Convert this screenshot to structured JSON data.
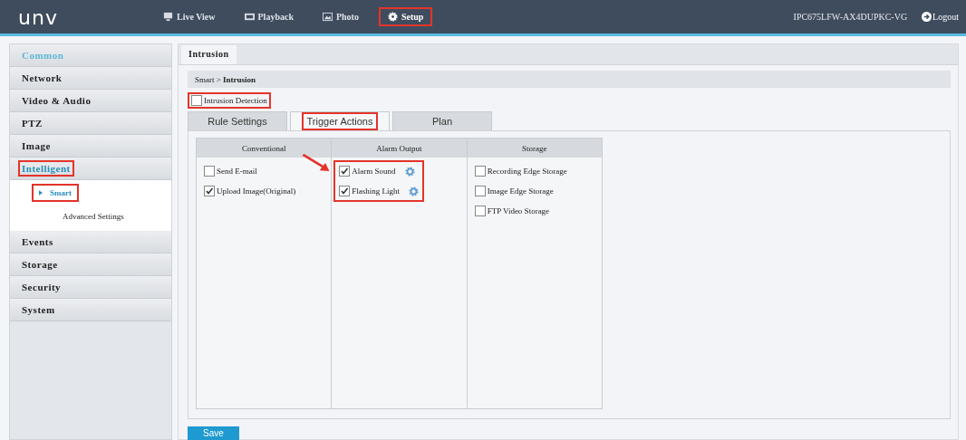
{
  "header": {
    "logo": "unv",
    "nav": [
      {
        "label": "Live View",
        "selected": false,
        "highlighted": false
      },
      {
        "label": "Playback",
        "selected": false,
        "highlighted": false
      },
      {
        "label": "Photo",
        "selected": false,
        "highlighted": false
      },
      {
        "label": "Setup",
        "selected": true,
        "highlighted": true
      }
    ],
    "device": "IPC675LFW-AX4DUPKC-VG",
    "logout": "Logout"
  },
  "sidebar": [
    {
      "label": "Common",
      "kind": "header",
      "selected": false,
      "highlighted": false
    },
    {
      "label": "Network",
      "kind": "item",
      "selected": false,
      "highlighted": false
    },
    {
      "label": "Video & Audio",
      "kind": "item",
      "selected": false,
      "highlighted": false
    },
    {
      "label": "PTZ",
      "kind": "item",
      "selected": false,
      "highlighted": false
    },
    {
      "label": "Image",
      "kind": "item",
      "selected": false,
      "highlighted": false
    },
    {
      "label": "Intelligent",
      "kind": "item",
      "selected": true,
      "highlighted": true,
      "children": [
        {
          "label": "Smart",
          "selected": true,
          "highlighted": true
        },
        {
          "label": "Advanced Settings",
          "selected": false,
          "highlighted": false
        }
      ]
    },
    {
      "label": "Events",
      "kind": "item",
      "selected": false,
      "highlighted": false
    },
    {
      "label": "Storage",
      "kind": "item",
      "selected": false,
      "highlighted": false
    },
    {
      "label": "Security",
      "kind": "item",
      "selected": false,
      "highlighted": false
    },
    {
      "label": "System",
      "kind": "item",
      "selected": false,
      "highlighted": false
    }
  ],
  "page_tab": "Intrusion",
  "breadcrumb": "Smart > **Intrusion**",
  "enable": {
    "label": "Intrusion Detection",
    "checked": false,
    "highlighted": true
  },
  "tabs": [
    {
      "label": "Rule Settings",
      "selected": false,
      "highlighted": false
    },
    {
      "label": "Trigger Actions",
      "selected": true,
      "highlighted": true
    },
    {
      "label": "Plan",
      "selected": false,
      "highlighted": false
    }
  ],
  "columns": [
    {
      "title": "Conventional",
      "highlighted": false,
      "options": [
        {
          "label": "Send E-mail",
          "checked": false,
          "settings": false
        },
        {
          "label": "Upload Image(Original)",
          "checked": true,
          "settings": false
        }
      ]
    },
    {
      "title": "Alarm Output",
      "highlighted": true,
      "options": [
        {
          "label": "Alarm Sound",
          "checked": true,
          "settings": true
        },
        {
          "label": "Flashing Light",
          "checked": true,
          "settings": true
        }
      ]
    },
    {
      "title": "Storage",
      "highlighted": false,
      "options": [
        {
          "label": "Recording Edge Storage",
          "checked": false,
          "settings": false
        },
        {
          "label": "Image Edge Storage",
          "checked": false,
          "settings": false
        },
        {
          "label": "FTP Video Storage",
          "checked": false,
          "settings": false
        }
      ]
    }
  ],
  "save": "Save"
}
